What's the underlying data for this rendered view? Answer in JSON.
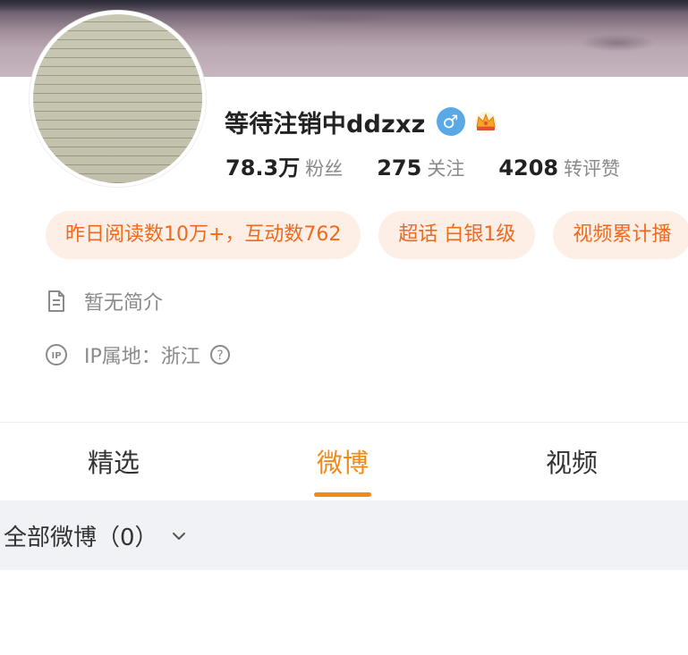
{
  "profile": {
    "username": "等待注销中ddzxz",
    "gender_symbol": "♂",
    "stats": [
      {
        "value": "78.3万",
        "label": "粉丝"
      },
      {
        "value": "275",
        "label": "关注"
      },
      {
        "value": "4208",
        "label": "转评赞"
      }
    ],
    "chips": [
      {
        "label": "昨日阅读数10万+，互动数762"
      },
      {
        "label": "超话 白银1级"
      },
      {
        "label": "视频累计播"
      }
    ],
    "bio": "暂无简介",
    "ip_location": "IP属地：浙江"
  },
  "tabs": [
    {
      "label": "精选",
      "active": false
    },
    {
      "label": "微博",
      "active": true
    },
    {
      "label": "视频",
      "active": false
    }
  ],
  "filter": {
    "label": "全部微博（0）"
  },
  "colors": {
    "accent": "#f28a16",
    "chip_text": "#f06a1c",
    "chip_bg": "#fdeee6",
    "gender_badge": "#5aa9e6",
    "muted_text": "#8a8a8a"
  },
  "icons": {
    "gender": "male-icon",
    "vip": "crown-icon",
    "bio": "document-icon",
    "ip": "ip-icon",
    "help": "question-circle-icon",
    "filter": "chevron-down-icon"
  }
}
